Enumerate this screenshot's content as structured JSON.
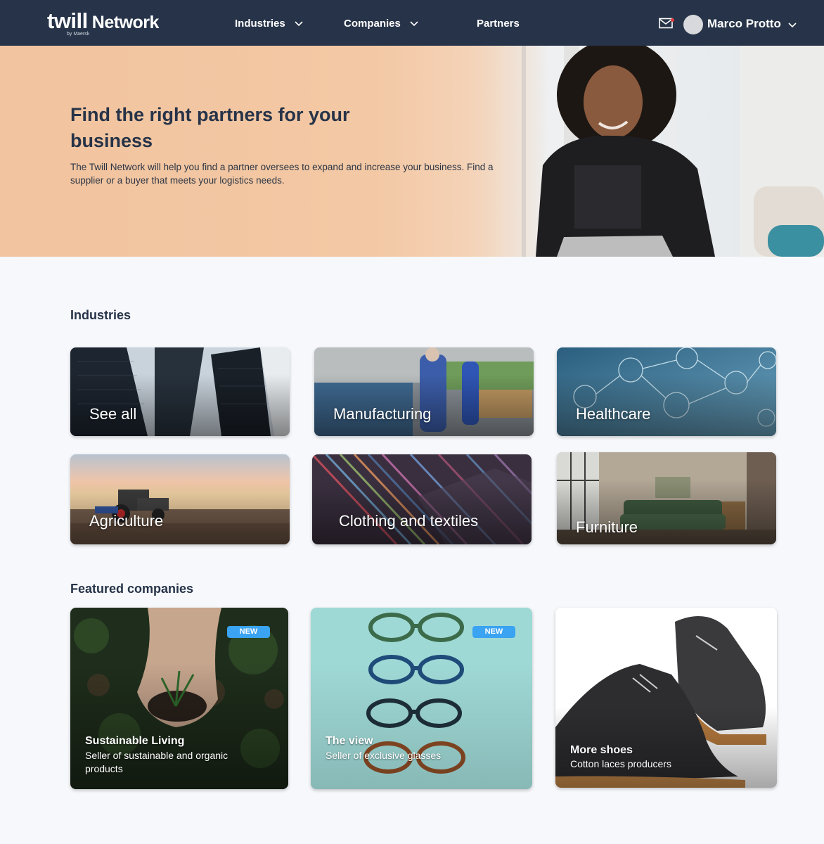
{
  "header": {
    "logo": {
      "word1": "twill",
      "word2": "Network",
      "byline": "by Maersk"
    },
    "nav": [
      {
        "label": "Industries"
      },
      {
        "label": "Companies"
      },
      {
        "label": "Partners"
      }
    ],
    "user": {
      "name": "Marco Protto"
    },
    "icons": [
      "mail-icon",
      "chevron-down-icon"
    ]
  },
  "hero": {
    "title": "Find the right partners for your business",
    "text": "The Twill Network will help you find a partner oversees to expand and increase your business. Find a supplier or a buyer that meets your logistics needs."
  },
  "industries": {
    "title": "Industries",
    "items": [
      {
        "label": "See all"
      },
      {
        "label": "Manufacturing"
      },
      {
        "label": "Healthcare"
      },
      {
        "label": "Agriculture"
      },
      {
        "label": "Clothing and textiles"
      },
      {
        "label": "Furniture"
      }
    ]
  },
  "featured": {
    "title": "Featured companies",
    "badge": "NEW",
    "items": [
      {
        "name": "Sustainable Living",
        "description": "Seller of sustainable and organic products",
        "is_new": true
      },
      {
        "name": "The view",
        "description": "Seller of exclusive glasses",
        "is_new": true
      },
      {
        "name": "More shoes",
        "description": "Cotton laces producers",
        "is_new": false
      }
    ]
  },
  "colors": {
    "header_bg": "#263348",
    "badge": "#3aa3f2",
    "page_bg": "#f6f8fb",
    "hero_peach": "#f2c49f"
  }
}
